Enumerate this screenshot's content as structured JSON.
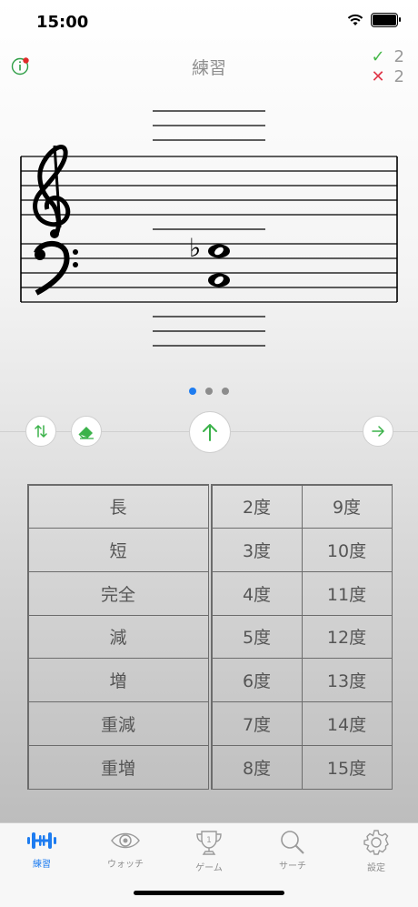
{
  "status_bar": {
    "time": "15:00"
  },
  "nav": {
    "title": "練習"
  },
  "score": {
    "correct": "2",
    "wrong": "2",
    "check_symbol": "✓",
    "cross_symbol": "✕"
  },
  "colors": {
    "accent": "#1e7cf0",
    "correct": "#46b84a",
    "wrong": "#e0384a"
  },
  "notation": {
    "clefs": [
      "treble",
      "bass"
    ],
    "notes": [
      "C4",
      "E♭4"
    ],
    "accidental": "♭"
  },
  "page_indicator": {
    "count": 3,
    "active_index": 0
  },
  "controls": {
    "swap_icon": "swap-vertical-icon",
    "erase_icon": "eraser-icon",
    "play_icon": "arrow-up-icon",
    "next_icon": "arrow-right-icon"
  },
  "qualities": [
    "長",
    "短",
    "完全",
    "減",
    "増",
    "重減",
    "重増"
  ],
  "intervals": [
    [
      "2度",
      "9度"
    ],
    [
      "3度",
      "10度"
    ],
    [
      "4度",
      "11度"
    ],
    [
      "5度",
      "12度"
    ],
    [
      "6度",
      "13度"
    ],
    [
      "7度",
      "14度"
    ],
    [
      "8度",
      "15度"
    ]
  ],
  "tabs": [
    {
      "label": "練習",
      "icon": "dumbbell-icon",
      "active": true
    },
    {
      "label": "ウォッチ",
      "icon": "eye-icon",
      "active": false
    },
    {
      "label": "ゲーム",
      "icon": "trophy-icon",
      "active": false
    },
    {
      "label": "サーチ",
      "icon": "search-icon",
      "active": false
    },
    {
      "label": "設定",
      "icon": "gear-icon",
      "active": false
    }
  ],
  "trophy_number": "1"
}
